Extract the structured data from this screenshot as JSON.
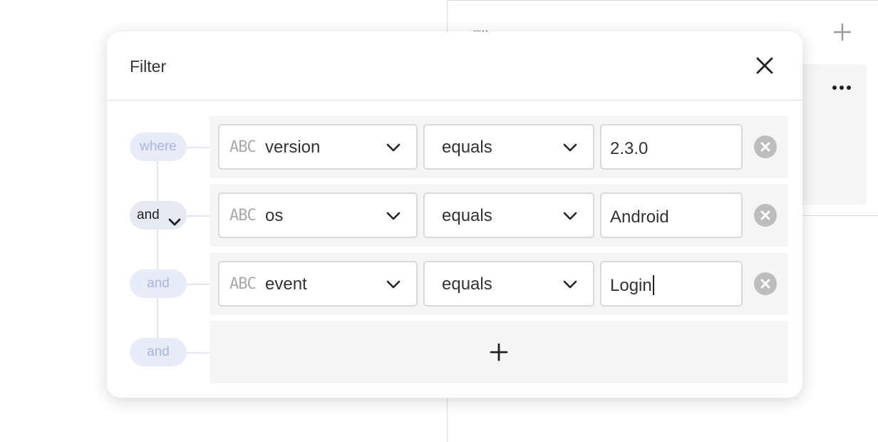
{
  "background": {
    "panel_title": "Filt",
    "add_icon": "plus-icon",
    "menu_icon": "more-horizontal-icon"
  },
  "filter_modal": {
    "title": "Filter",
    "close_icon": "close-icon",
    "connectors": [
      "where",
      "and",
      "and",
      "and"
    ],
    "rules": [
      {
        "type_badge": "ABC",
        "property": "version",
        "operator": "equals",
        "value": "2.3.0"
      },
      {
        "type_badge": "ABC",
        "property": "os",
        "operator": "equals",
        "value": "Android"
      },
      {
        "type_badge": "ABC",
        "property": "event",
        "operator": "equals",
        "value": "Login"
      }
    ],
    "add_rule_icon": "plus-icon",
    "remove_rule_icon": "remove-circle-icon",
    "dropdown_icon": "chevron-down-icon"
  },
  "colors": {
    "pill_bg": "#e8ecf8",
    "pill_text": "#aab5e3",
    "row_bg": "#f5f5f5",
    "remove_btn": "#bdbdbd"
  }
}
